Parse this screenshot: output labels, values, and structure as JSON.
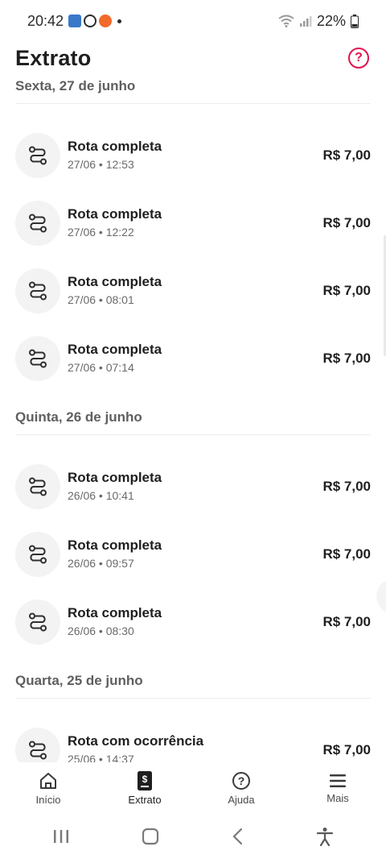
{
  "status_bar": {
    "time": "20:42",
    "battery": "22%"
  },
  "header": {
    "title": "Extrato",
    "help_icon": "help-circle-icon"
  },
  "days": [
    {
      "label": "Sexta, 27 de junho",
      "items": [
        {
          "title": "Rota completa",
          "subtitle": "27/06 • 12:53",
          "amount": "R$ 7,00"
        },
        {
          "title": "Rota completa",
          "subtitle": "27/06 • 12:22",
          "amount": "R$ 7,00"
        },
        {
          "title": "Rota completa",
          "subtitle": "27/06 • 08:01",
          "amount": "R$ 7,00"
        },
        {
          "title": "Rota completa",
          "subtitle": "27/06 • 07:14",
          "amount": "R$ 7,00"
        }
      ]
    },
    {
      "label": "Quinta, 26 de junho",
      "items": [
        {
          "title": "Rota completa",
          "subtitle": "26/06 • 10:41",
          "amount": "R$ 7,00"
        },
        {
          "title": "Rota completa",
          "subtitle": "26/06 • 09:57",
          "amount": "R$ 7,00"
        },
        {
          "title": "Rota completa",
          "subtitle": "26/06 • 08:30",
          "amount": "R$ 7,00"
        }
      ]
    },
    {
      "label": "Quarta, 25 de junho",
      "items": [
        {
          "title": "Rota com ocorrência",
          "subtitle": "25/06 • 14:37",
          "amount": "R$ 7,00"
        }
      ]
    }
  ],
  "bottom_nav": [
    {
      "label": "Início",
      "icon": "home-icon",
      "active": false
    },
    {
      "label": "Extrato",
      "icon": "statement-icon",
      "active": true
    },
    {
      "label": "Ajuda",
      "icon": "help-circle-icon",
      "active": false
    },
    {
      "label": "Mais",
      "icon": "menu-icon",
      "active": false
    }
  ],
  "colors": {
    "accent": "#e0134f",
    "text": "#1f1f1f",
    "muted": "#6a6a6a",
    "icon_bg": "#f3f3f3"
  }
}
